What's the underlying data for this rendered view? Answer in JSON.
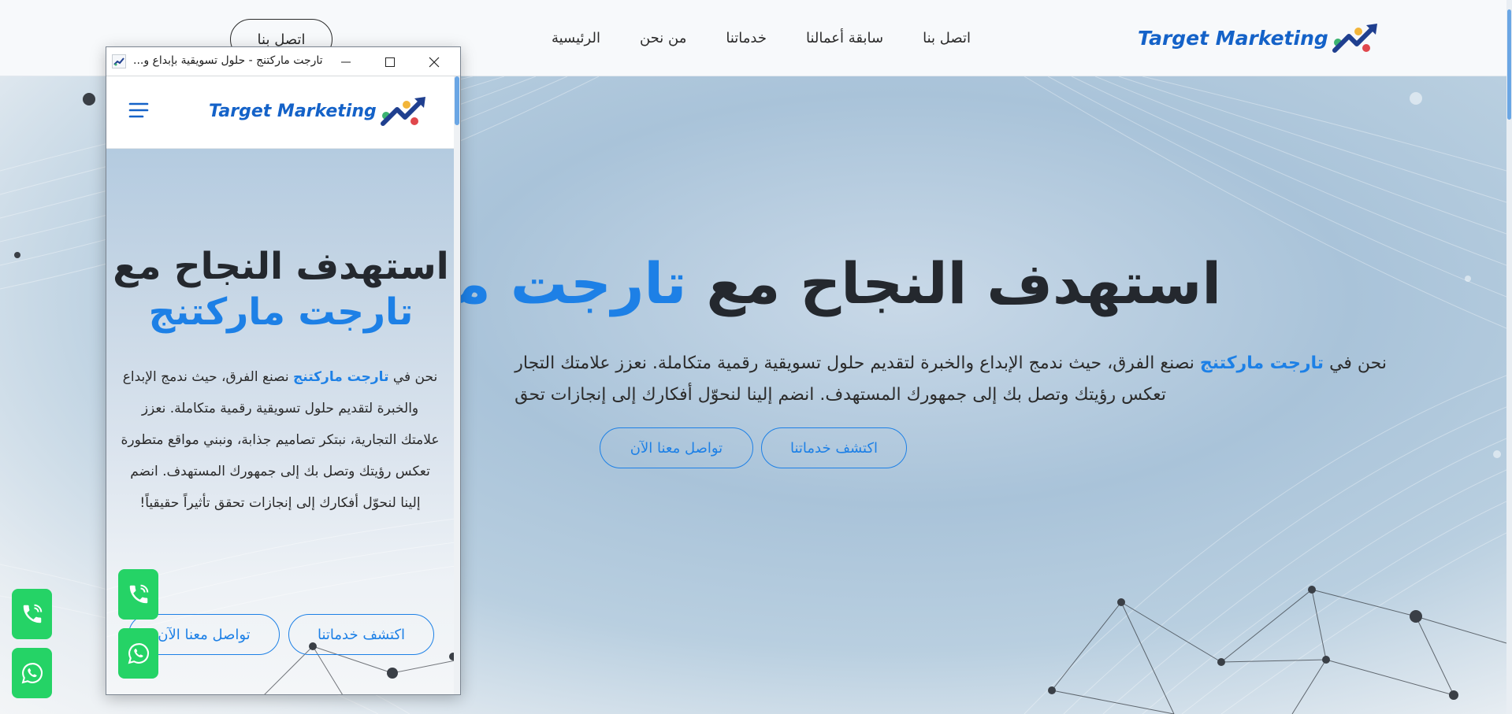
{
  "brand": {
    "name": "Target Marketing"
  },
  "nav": {
    "links": [
      "الرئيسية",
      "من نحن",
      "خدماتنا",
      "سابقة أعمالنا",
      "اتصل بنا"
    ],
    "contact_button": "اتصل بنا"
  },
  "hero": {
    "title_main": "استهدف النجاح مع",
    "title_accent": "تارجت مار",
    "text_prefix": "نحن في",
    "text_accent": "تارجت ماركتنج",
    "text_line1_rest": "نصنع الفرق، حيث ندمج الإبداع والخبرة لتقديم حلول تسويقية رقمية متكاملة. نعزز علامتك التجار",
    "text_line2": "تعكس رؤيتك وتصل بك إلى جمهورك المستهدف. انضم إلينا لنحوّل أفكارك إلى إنجازات تحق",
    "btn_services": "اكتشف خدماتنا",
    "btn_contact": "تواصل معنا الآن"
  },
  "popup": {
    "window_title": "تارجت ماركتنج - حلول تسويقية بإبداع و...",
    "title_main": "استهدف النجاح مع",
    "title_accent": "تارجت ماركتنج",
    "text_prefix": "نحن في",
    "text_accent": "تارجت ماركتنج",
    "text_rest": "نصنع الفرق، حيث ندمج الإبداع والخبرة لتقديم حلول تسويقية رقمية متكاملة. نعزز علامتك التجارية، نبتكر تصاميم جذابة، ونبني مواقع متطورة تعكس رؤيتك وتصل بك إلى جمهورك المستهدف. انضم إلينا لنحوّل أفكارك إلى إنجازات تحقق تأثيراً حقيقياً!",
    "btn_services": "اكتشف خدماتنا",
    "btn_contact": "تواصل معنا الآن"
  },
  "icons": {
    "logo": "trend-arrow-logo-icon",
    "menu": "hamburger-menu-icon",
    "phone": "phone-icon",
    "whatsapp": "whatsapp-icon",
    "minimize": "minimize-icon",
    "maximize": "maximize-icon",
    "close": "close-icon"
  },
  "colors": {
    "accent": "#1d80e6",
    "brand": "#1462c8",
    "whatsapp": "#25d366"
  }
}
